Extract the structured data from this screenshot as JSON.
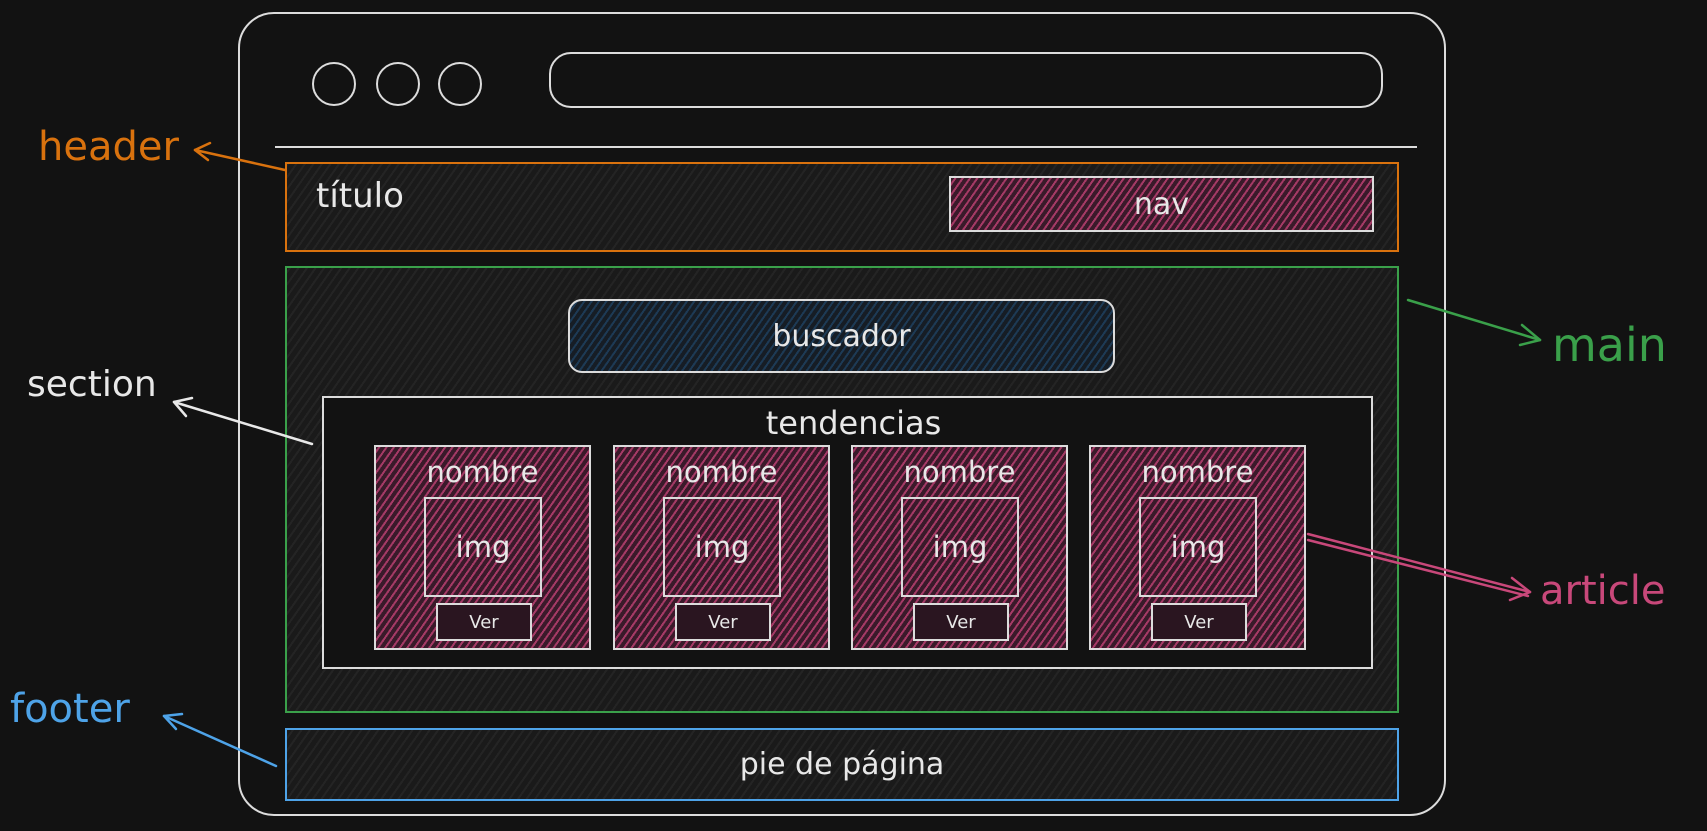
{
  "header": {
    "title": "título",
    "nav": "nav"
  },
  "main": {
    "search": "buscador",
    "section": {
      "title": "tendencias",
      "articles": [
        {
          "name": "nombre",
          "img": "img",
          "button": "Ver"
        },
        {
          "name": "nombre",
          "img": "img",
          "button": "Ver"
        },
        {
          "name": "nombre",
          "img": "img",
          "button": "Ver"
        },
        {
          "name": "nombre",
          "img": "img",
          "button": "Ver"
        }
      ]
    }
  },
  "footer": {
    "text": "pie de página"
  },
  "labels": {
    "header": "header",
    "main": "main",
    "section": "section",
    "article": "article",
    "footer": "footer"
  },
  "colors": {
    "header": "#d9720e",
    "main": "#3aa04a",
    "section": "#e8e8e8",
    "article": "#c8487a",
    "footer": "#4ea3e8"
  }
}
